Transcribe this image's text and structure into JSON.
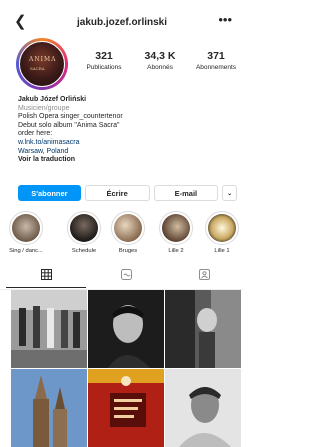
{
  "header": {
    "back_icon": "chevron-left-icon",
    "username": "jakub.jozef.orlinski",
    "more_icon": "more-dots-icon"
  },
  "profile": {
    "posts_count": "321",
    "posts_label": "Publications",
    "followers_count": "34,3 K",
    "followers_label": "Abonnés",
    "following_count": "371",
    "following_label": "Abonnements"
  },
  "bio": {
    "name": "Jakub Józef Orliński",
    "category": "Musicien/groupe",
    "line1": "Polish Opera singer_countertenor",
    "line2": "Debut solo album \"Anima Sacra\"",
    "line3": "order here:",
    "link": "w.lnk.to/animasacra",
    "location": "Warsaw, Poland",
    "translate": "Voir la traduction"
  },
  "buttons": {
    "follow": "S'abonner",
    "write": "Écrire",
    "email": "E-mail",
    "chevron": "⌄"
  },
  "highlights": [
    {
      "label": "Sing / danc..."
    },
    {
      "label": "Schedule"
    },
    {
      "label": "Bruges"
    },
    {
      "label": "Lille 2"
    },
    {
      "label": "Lille 1"
    }
  ],
  "tabs": {
    "grid_icon": "grid-icon",
    "reels_icon": "reels-icon",
    "tagged_icon": "tagged-icon"
  },
  "avatar_text": {
    "line1": "ANIMA",
    "line2": "SACRA"
  },
  "colors": {
    "accent": "#0095f6",
    "text": "#262626",
    "link": "#00376b"
  }
}
